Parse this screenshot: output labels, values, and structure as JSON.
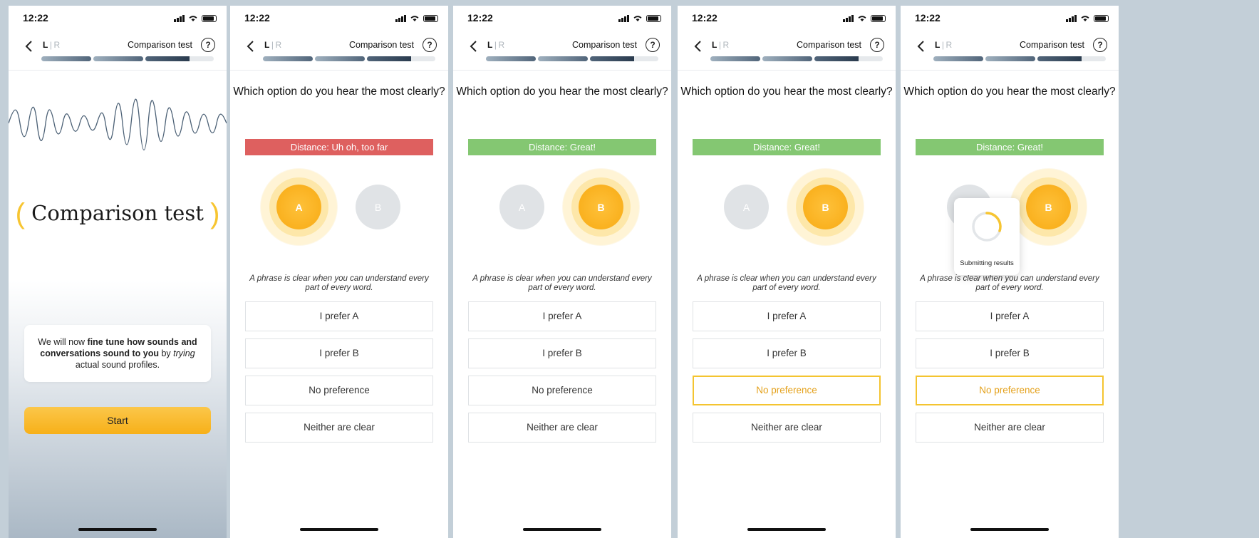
{
  "status_time": "12:22",
  "nav": {
    "left_ear": "L",
    "right_ear": "R",
    "title": "Comparison test",
    "help": "?"
  },
  "intro": {
    "heading": "Comparison test",
    "info_pre": "We will now ",
    "info_bold": "fine tune how sounds and conversations sound to you",
    "info_mid": " by ",
    "info_italic": "trying",
    "info_post": " actual sound profiles.",
    "start_label": "Start"
  },
  "question": "Which option do you hear the most clearly?",
  "hint": "A phrase is clear when you can understand every part of every word.",
  "option_a": "A",
  "option_b": "B",
  "answers": [
    "I prefer A",
    "I prefer B",
    "No preference",
    "Neither are clear"
  ],
  "screens": [
    {
      "distance": "Distance: Uh oh, too far",
      "distance_status": "bad",
      "active_option": "A",
      "selected_answer": null
    },
    {
      "distance": "Distance: Great!",
      "distance_status": "good",
      "active_option": "B",
      "selected_answer": null
    },
    {
      "distance": "Distance: Great!",
      "distance_status": "good",
      "active_option": "B",
      "selected_answer": "No preference"
    },
    {
      "distance": "Distance: Great!",
      "distance_status": "good",
      "active_option": "B",
      "selected_answer": "No preference",
      "overlay": "Submitting results"
    }
  ],
  "colors": {
    "accent": "#f7b019",
    "bad": "#de605f",
    "good": "#84c772",
    "selected_border": "#f4c430"
  }
}
